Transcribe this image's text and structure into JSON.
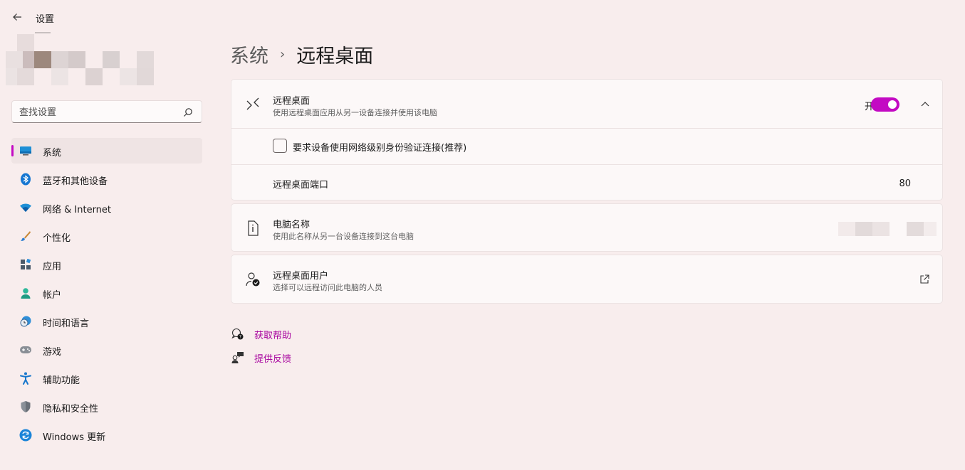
{
  "app": {
    "title": "设置"
  },
  "search": {
    "placeholder": "查找设置"
  },
  "sidebar": {
    "items": [
      {
        "label": "系统",
        "icon": "monitor-icon",
        "active": true
      },
      {
        "label": "蓝牙和其他设备",
        "icon": "bluetooth-icon"
      },
      {
        "label": "网络 & Internet",
        "icon": "wifi-icon"
      },
      {
        "label": "个性化",
        "icon": "brush-icon"
      },
      {
        "label": "应用",
        "icon": "apps-icon"
      },
      {
        "label": "帐户",
        "icon": "account-icon"
      },
      {
        "label": "时间和语言",
        "icon": "clock-globe-icon"
      },
      {
        "label": "游戏",
        "icon": "gamepad-icon"
      },
      {
        "label": "辅助功能",
        "icon": "accessibility-icon"
      },
      {
        "label": "隐私和安全性",
        "icon": "shield-icon"
      },
      {
        "label": "Windows 更新",
        "icon": "update-icon"
      }
    ]
  },
  "breadcrumb": {
    "parent": "系统",
    "separator": "›",
    "current": "远程桌面"
  },
  "remote_desktop": {
    "title": "远程桌面",
    "subtitle": "使用远程桌面应用从另一设备连接并使用该电脑",
    "toggle_state": "开",
    "toggle_on": true,
    "nla_checkbox_label": "要求设备使用网络级别身份验证连接(推荐)",
    "nla_checked": false,
    "port_label": "远程桌面端口",
    "port_value": "80"
  },
  "pc_name": {
    "title": "电脑名称",
    "subtitle": "使用此名称从另一台设备连接到这台电脑"
  },
  "rd_users": {
    "title": "远程桌面用户",
    "subtitle": "选择可以远程访问此电脑的人员"
  },
  "links": {
    "help": "获取帮助",
    "feedback": "提供反馈"
  },
  "colors": {
    "accent": "#c30ac3",
    "link": "#a8069f",
    "background": "#f8eded"
  }
}
